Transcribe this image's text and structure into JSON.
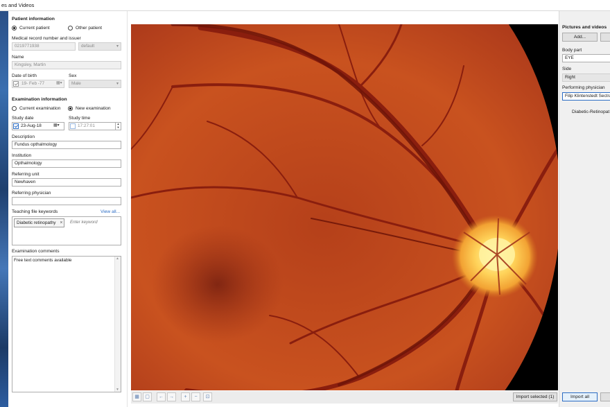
{
  "window": {
    "title": "es and Videos"
  },
  "patient": {
    "header": "Patient information",
    "radio_current": "Current patient",
    "radio_other": "Other patient",
    "mrn_label": "Medical record number and issuer",
    "mrn_value": "0219771938",
    "issuer_value": "default",
    "name_label": "Name",
    "name_value": "Kingsley, Martin",
    "dob_label": "Date of birth",
    "dob_value": "19- Feb -77",
    "sex_label": "Sex",
    "sex_value": "Male"
  },
  "exam": {
    "header": "Examination information",
    "radio_current": "Current examination",
    "radio_new": "New examination",
    "study_date_label": "Study date",
    "study_date_value": "23-Aug-18",
    "study_time_label": "Study time",
    "study_time_value": "17:27:01",
    "description_label": "Description",
    "description_value": "Fundus opthalmology",
    "institution_label": "Institution",
    "institution_value": "Opthalmology",
    "referring_unit_label": "Referring unit",
    "referring_unit_value": "Newhaven",
    "referring_physician_label": "Referring physician",
    "referring_physician_value": "",
    "keywords_label": "Teaching file keywords",
    "view_all": "View all...",
    "keyword_chip": "Diabetic retinopathy",
    "keyword_placeholder": "Enter keyword",
    "comments_label": "Examination comments",
    "comments_value": "Free text comments available"
  },
  "right": {
    "header": "Pictures and videos",
    "add_button": "Add...",
    "body_part_label": "Body part",
    "body_part_value": "EYE",
    "side_label": "Side",
    "side_value": "Right",
    "performing_label": "Performing physician",
    "performing_value": "Filip Klintenstedt Sectra",
    "item_caption": "Diabetic-Retinopat"
  },
  "bottom": {
    "import_selected": "Import selected (1)",
    "import_all": "Import all"
  },
  "icons": [
    "grid-icon",
    "single-view-icon",
    "arrow-left-icon",
    "arrow-right-icon",
    "zoom-in-icon",
    "zoom-out-icon",
    "fit-icon"
  ],
  "colors": {
    "accent": "#2b6cc4",
    "fundus_base": "#b8401b",
    "optic_disc": "#ffd36a"
  }
}
